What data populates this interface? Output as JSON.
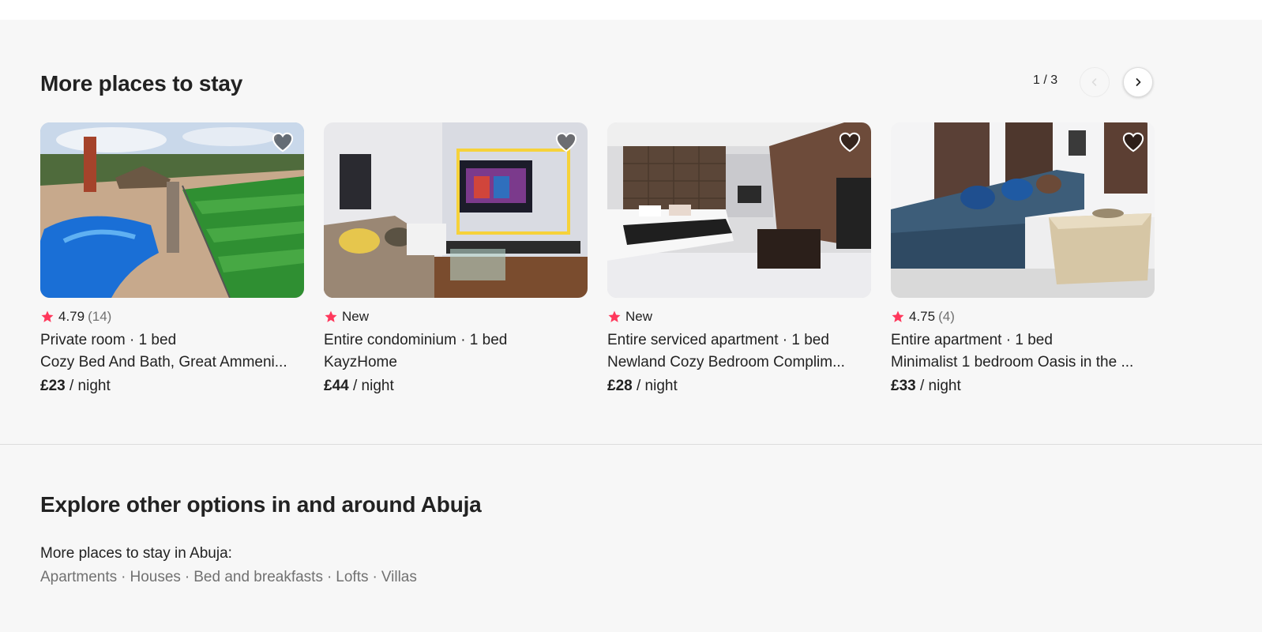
{
  "section": {
    "title": "More places to stay",
    "pager": "1 / 3"
  },
  "listings": [
    {
      "rating": "4.79",
      "reviews": "(14)",
      "type": "Private room · 1 bed",
      "name": "Cozy Bed And Bath, Great Ammeni...",
      "price": "£23",
      "per": " / night"
    },
    {
      "rating": "New",
      "reviews": "",
      "type": "Entire condominium · 1 bed",
      "name": "KayzHome",
      "price": "£44",
      "per": " / night"
    },
    {
      "rating": "New",
      "reviews": "",
      "type": "Entire serviced apartment · 1 bed",
      "name": "Newland Cozy Bedroom Complim...",
      "price": "£28",
      "per": " / night"
    },
    {
      "rating": "4.75",
      "reviews": "(4)",
      "type": "Entire apartment · 1 bed",
      "name": "Minimalist 1 bedroom Oasis in the ...",
      "price": "£33",
      "per": " / night"
    }
  ],
  "explore": {
    "title": "Explore other options in and around Abuja",
    "subtitle": "More places to stay in Abuja:",
    "links": [
      "Apartments",
      "Houses",
      "Bed and breakfasts",
      "Lofts",
      "Villas"
    ],
    "separator": "·"
  },
  "colors": {
    "star": "#ff385c",
    "text": "#222222",
    "muted": "#717171",
    "background": "#f7f7f7"
  },
  "icons": {
    "prev": "chevron-left-icon",
    "next": "chevron-right-icon",
    "favorite": "heart-icon",
    "rating": "star-icon"
  }
}
